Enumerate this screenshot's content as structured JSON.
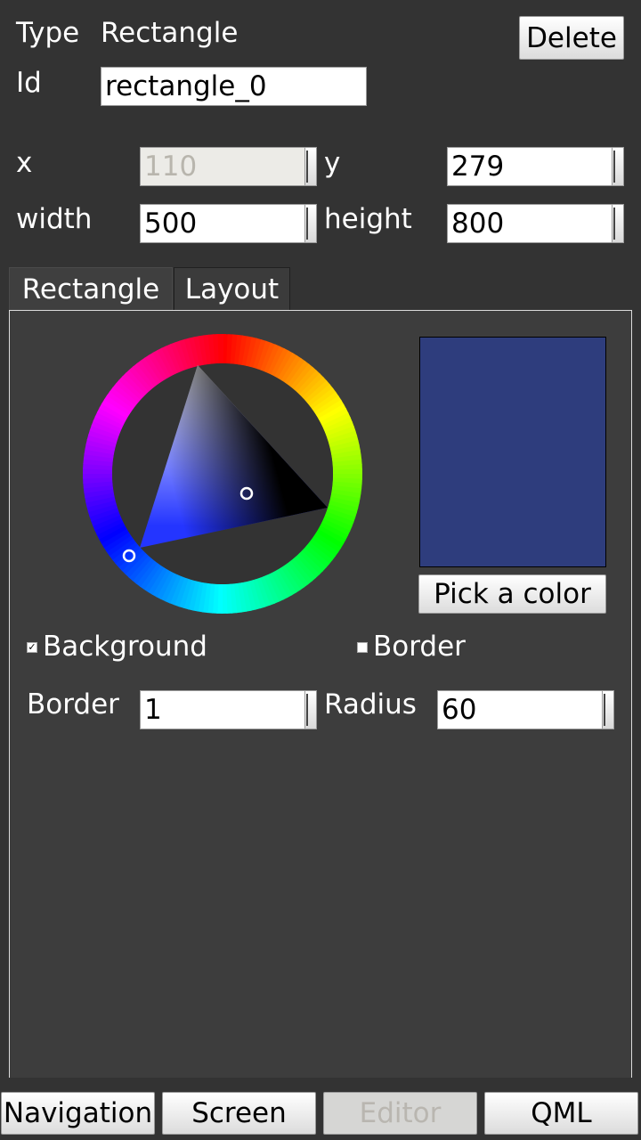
{
  "header": {
    "type_label": "Type",
    "type_value": "Rectangle",
    "id_label": "Id",
    "id_value": "rectangle_0",
    "delete_label": "Delete"
  },
  "geometry": {
    "x_label": "x",
    "x_value": "110",
    "y_label": "y",
    "y_value": "279",
    "width_label": "width",
    "width_value": "500",
    "height_label": "height",
    "height_value": "800"
  },
  "tabs": [
    {
      "label": "Rectangle",
      "active": true
    },
    {
      "label": "Layout",
      "active": false
    }
  ],
  "color_picker": {
    "selected_color": "#2e3d7d",
    "pick_label": "Pick a color"
  },
  "options": {
    "background_label": "Background",
    "background_checked": true,
    "border_label": "Border",
    "border_checked": false,
    "border_width_label": "Border",
    "border_width_value": "1",
    "radius_label": "Radius",
    "radius_value": "60"
  },
  "bottom_nav": [
    {
      "label": "Navigation",
      "enabled": true
    },
    {
      "label": "Screen",
      "enabled": true
    },
    {
      "label": "Editor",
      "enabled": false
    },
    {
      "label": "QML",
      "enabled": true
    }
  ]
}
